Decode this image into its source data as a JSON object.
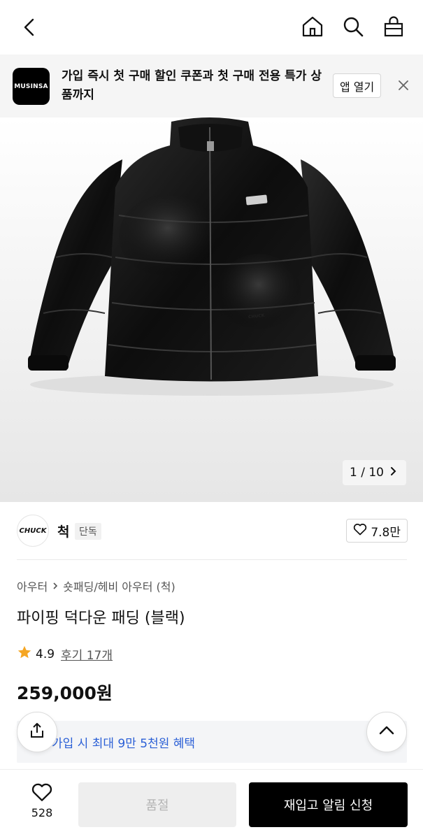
{
  "banner": {
    "logo_text": "MUSINSA",
    "message": "가입 즉시 첫 구매 할인 쿠폰과 첫 구매 전용 특가 상품까지",
    "open_app_label": "앱 열기"
  },
  "gallery": {
    "current": "1",
    "separator": "/",
    "total": "10",
    "jacket_badge": "CHUCK"
  },
  "brand": {
    "logo_text": "CHUCK",
    "name": "척",
    "badge": "단독",
    "likes": "7.8만"
  },
  "product": {
    "breadcrumb": [
      "아우터",
      "숏패딩/헤비 아우터 (척)"
    ],
    "title": "파이핑 덕다운 패딩 (블랙)",
    "rating": "4.9",
    "reviews": "후기 17개",
    "price": "259,000원",
    "benefit": "가입 시 최대 9만 5천원 혜택"
  },
  "bottom": {
    "like_count": "528",
    "size_label": "품절",
    "restock_label": "재입고 알림 신청"
  },
  "colors": {
    "accent_blue": "#2a5fd6",
    "star": "#f5a623",
    "primary_button": "#000000"
  }
}
